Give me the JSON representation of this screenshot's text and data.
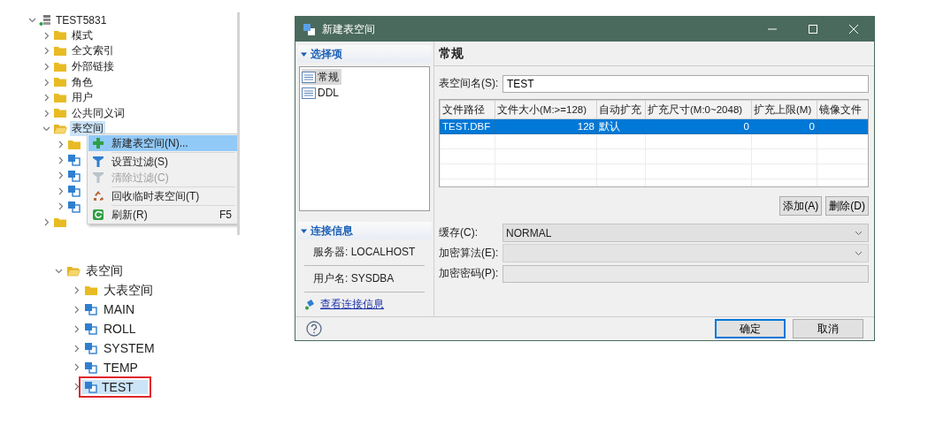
{
  "tree_top": {
    "root": {
      "label": "TEST5831",
      "expanded": true,
      "children": [
        {
          "kind": "folder",
          "label": "模式",
          "expanded": false,
          "selected": false
        },
        {
          "kind": "folder",
          "label": "全文索引",
          "expanded": false,
          "selected": false
        },
        {
          "kind": "folder",
          "label": "外部链接",
          "expanded": false,
          "selected": false
        },
        {
          "kind": "folder",
          "label": "角色",
          "expanded": false,
          "selected": false
        },
        {
          "kind": "folder",
          "label": "用户",
          "expanded": false,
          "selected": false
        },
        {
          "kind": "folder",
          "label": "公共同义词",
          "expanded": false,
          "selected": false
        },
        {
          "kind": "folder",
          "label": "表空间",
          "expanded": true,
          "selected": true,
          "children": [
            {
              "kind": "folder",
              "expanded": false
            },
            {
              "kind": "tablespace",
              "expanded": false
            },
            {
              "kind": "tablespace",
              "expanded": false
            },
            {
              "kind": "tablespace",
              "expanded": false
            },
            {
              "kind": "tablespace",
              "expanded": false
            }
          ]
        },
        {
          "kind": "folder",
          "expanded": false
        }
      ]
    },
    "context_menu": [
      {
        "kind": "add",
        "label": "新建表空间(N)...",
        "selected": true,
        "disabled": false
      },
      {
        "kind": "separator"
      },
      {
        "kind": "filter",
        "label": "设置过滤(S)",
        "selected": false,
        "disabled": false
      },
      {
        "kind": "filter",
        "label": "清除过滤(C)",
        "selected": false,
        "disabled": true
      },
      {
        "kind": "separator"
      },
      {
        "kind": "recycle",
        "label": "回收临时表空间(T)",
        "selected": false,
        "disabled": false
      },
      {
        "kind": "separator"
      },
      {
        "kind": "refresh",
        "label": "刷新(R)",
        "shortcut": "F5",
        "selected": false,
        "disabled": false
      }
    ]
  },
  "tree_bottom": {
    "root": {
      "kind": "folder",
      "label": "表空间",
      "expanded": true,
      "children": [
        {
          "kind": "folder",
          "label": "大表空间",
          "expanded": false,
          "selected": false,
          "annotated": false
        },
        {
          "kind": "tablespace",
          "label": "MAIN",
          "expanded": false,
          "selected": false,
          "annotated": false
        },
        {
          "kind": "tablespace",
          "label": "ROLL",
          "expanded": false,
          "selected": false,
          "annotated": false
        },
        {
          "kind": "tablespace",
          "label": "SYSTEM",
          "expanded": false,
          "selected": false,
          "annotated": false
        },
        {
          "kind": "tablespace",
          "label": "TEMP",
          "expanded": false,
          "selected": false,
          "annotated": false
        },
        {
          "kind": "tablespace",
          "label": "TEST",
          "expanded": false,
          "selected": true,
          "annotated": true
        }
      ]
    }
  },
  "dialog": {
    "title": "新建表空间",
    "options_section": {
      "title": "选择项",
      "expanded": true,
      "items": [
        {
          "label": "常规",
          "selected": true
        },
        {
          "label": "DDL",
          "selected": false
        }
      ]
    },
    "connection_section": {
      "title": "连接信息",
      "expanded": true,
      "server": "服务器: LOCALHOST",
      "user": "用户名: SYSDBA",
      "link": "查看连接信息"
    },
    "page_title": "常规",
    "name_field": {
      "label": "表空间名(S):",
      "value": "TEST"
    },
    "table": {
      "columns": [
        "文件路径",
        "文件大小(M:>=128)",
        "自动扩充",
        "扩充尺寸(M:0~2048)",
        "扩充上限(M)",
        "镜像文件"
      ],
      "rows": [
        {
          "cells": [
            "TEST.DBF",
            "128",
            "默认",
            "0",
            "0",
            ""
          ],
          "selected": true
        }
      ]
    },
    "table_buttons": [
      "添加(A)",
      "删除(D)"
    ],
    "cache_field": {
      "label": "缓存(C):",
      "value": "NORMAL",
      "disabled": false
    },
    "encrypt_field": {
      "label": "加密算法(E):",
      "disabled": true
    },
    "password_field": {
      "label": "加密密码(P):",
      "disabled": true
    },
    "buttons": [
      {
        "label": "确定",
        "default": true
      },
      {
        "label": "取消",
        "default": false
      }
    ]
  }
}
